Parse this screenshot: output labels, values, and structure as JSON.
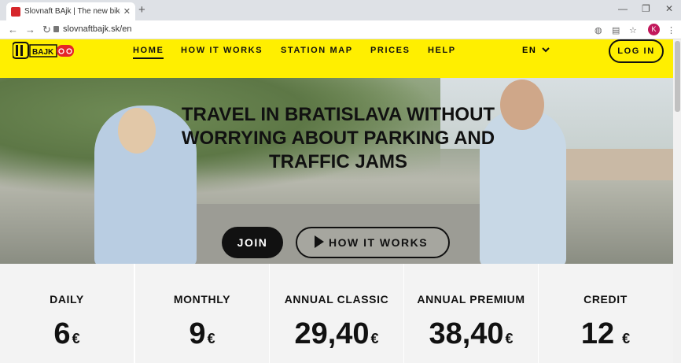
{
  "browser": {
    "tab_title": "Slovnaft BAjk | The new bike sha",
    "tab_close": "✕",
    "new_tab": "+",
    "window_minimize": "—",
    "window_restore": "❐",
    "window_close": "✕",
    "url": "slovnaftbajk.sk/en",
    "profile_initial": "K"
  },
  "header": {
    "logo_text": "BAJK",
    "nav": {
      "home": "HOME",
      "how_it_works": "HOW IT WORKS",
      "station_map": "STATION MAP",
      "prices": "PRICES",
      "help": "HELP"
    },
    "language": "EN",
    "login": "LOG IN"
  },
  "hero": {
    "headline_line1": "TRAVEL IN BRATISLAVA WITHOUT",
    "headline_line2": "WORRYING ABOUT PARKING AND",
    "headline_line3": "TRAFFIC JAMS",
    "join_label": "JOIN",
    "how_label": "HOW IT WORKS"
  },
  "plans": [
    {
      "name": "DAILY",
      "price": "6",
      "currency": "€"
    },
    {
      "name": "MONTHLY",
      "price": "9",
      "currency": "€"
    },
    {
      "name": "ANNUAL CLASSIC",
      "price": "29,40",
      "currency": "€"
    },
    {
      "name": "ANNUAL PREMIUM",
      "price": "38,40",
      "currency": "€"
    },
    {
      "name": "CREDIT",
      "price": "12",
      "currency": "€"
    }
  ],
  "colors": {
    "brand_yellow": "#ffef00",
    "text_dark": "#111111"
  }
}
